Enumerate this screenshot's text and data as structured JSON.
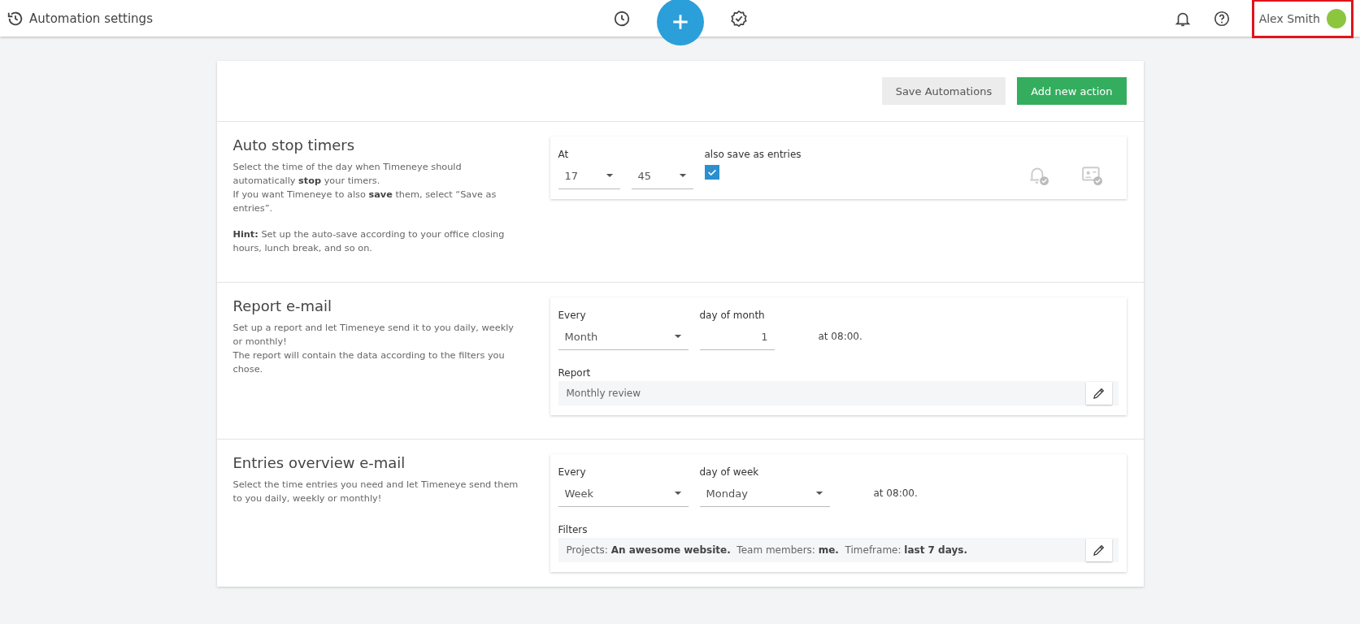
{
  "header": {
    "title": "Automation settings",
    "user": {
      "name": "Alex Smith",
      "highlighted": true
    }
  },
  "toolbar": {
    "buttons": [
      {
        "label": "Save Automations",
        "kind": "secondary"
      },
      {
        "label": "Add new action",
        "kind": "primary"
      }
    ]
  },
  "sections": [
    {
      "title": "Auto stop timers",
      "description": [
        [
          "Select the time of the day when Timeneye should",
          "automatically **stop** your timers.",
          "If you want Timeneye to also **save** them, select “Save as",
          "entries”."
        ],
        [
          "**Hint:** Set up the auto-save according to your office closing",
          "hours, lunch break, and so on."
        ]
      ],
      "panel": {
        "fields": [
          {
            "kind": "select-short",
            "label": "At",
            "value": "17"
          },
          {
            "kind": "select-short",
            "value": "45"
          },
          {
            "kind": "checkbox",
            "label": "also save as entries",
            "checked": true
          }
        ],
        "status_icons": true
      }
    },
    {
      "title": "Report e-mail",
      "description": [
        [
          "Set up a report and let Timeneye send it to you daily, weekly",
          "or monthly!",
          "The report will contain the data according to the filters you",
          "chose."
        ]
      ],
      "panel": {
        "fields": [
          {
            "kind": "select",
            "label": "Every",
            "value": "Month"
          },
          {
            "kind": "number",
            "label": "day of month",
            "value": "1"
          }
        ],
        "note": "at 08:00.",
        "box": {
          "label": "Report",
          "value": "Monthly review"
        }
      }
    },
    {
      "title": "Entries overview e-mail",
      "description": [
        [
          "Select the time entries you need and let Timeneye send them",
          "to you daily, weekly or monthly!"
        ]
      ],
      "panel": {
        "fields": [
          {
            "kind": "select",
            "label": "Every",
            "value": "Week"
          },
          {
            "kind": "select",
            "label": "day of week",
            "value": "Monday"
          }
        ],
        "note": "at 08:00.",
        "box": {
          "label": "Filters",
          "value": "Projects: **An awesome website.**  Team members: **me.**  Timeframe: **last 7 days.**"
        }
      }
    }
  ]
}
